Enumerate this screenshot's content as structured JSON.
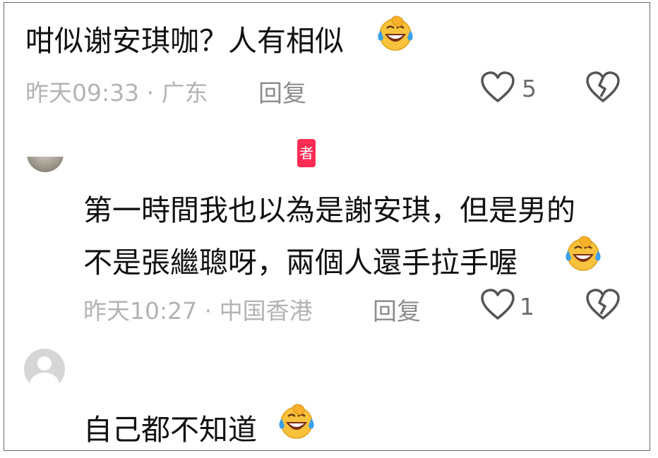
{
  "comments": [
    {
      "text": "咁似谢安琪咖？人有相似",
      "emoji": "face-with-tears-of-joy-icon",
      "meta": "昨天09:33 · 广东",
      "reply_label": "回复",
      "likes": "5"
    },
    {
      "badge": "者",
      "line1": "第一時間我也以為是謝安琪，但是男的",
      "line2": "不是張繼聰呀，兩個人還手拉手喔",
      "emoji": "face-with-tears-of-joy-icon",
      "meta": "昨天10:27 · 中国香港",
      "reply_label": "回复",
      "likes": "1"
    },
    {
      "text": "自己都不知道",
      "emoji": "face-with-tears-of-joy-icon"
    }
  ],
  "colors": {
    "text": "#111111",
    "meta": "#b3b3b3",
    "badge": "#fe2c55",
    "emoji_face": "#f9c23c",
    "emoji_tears": "#3aa0e8"
  }
}
